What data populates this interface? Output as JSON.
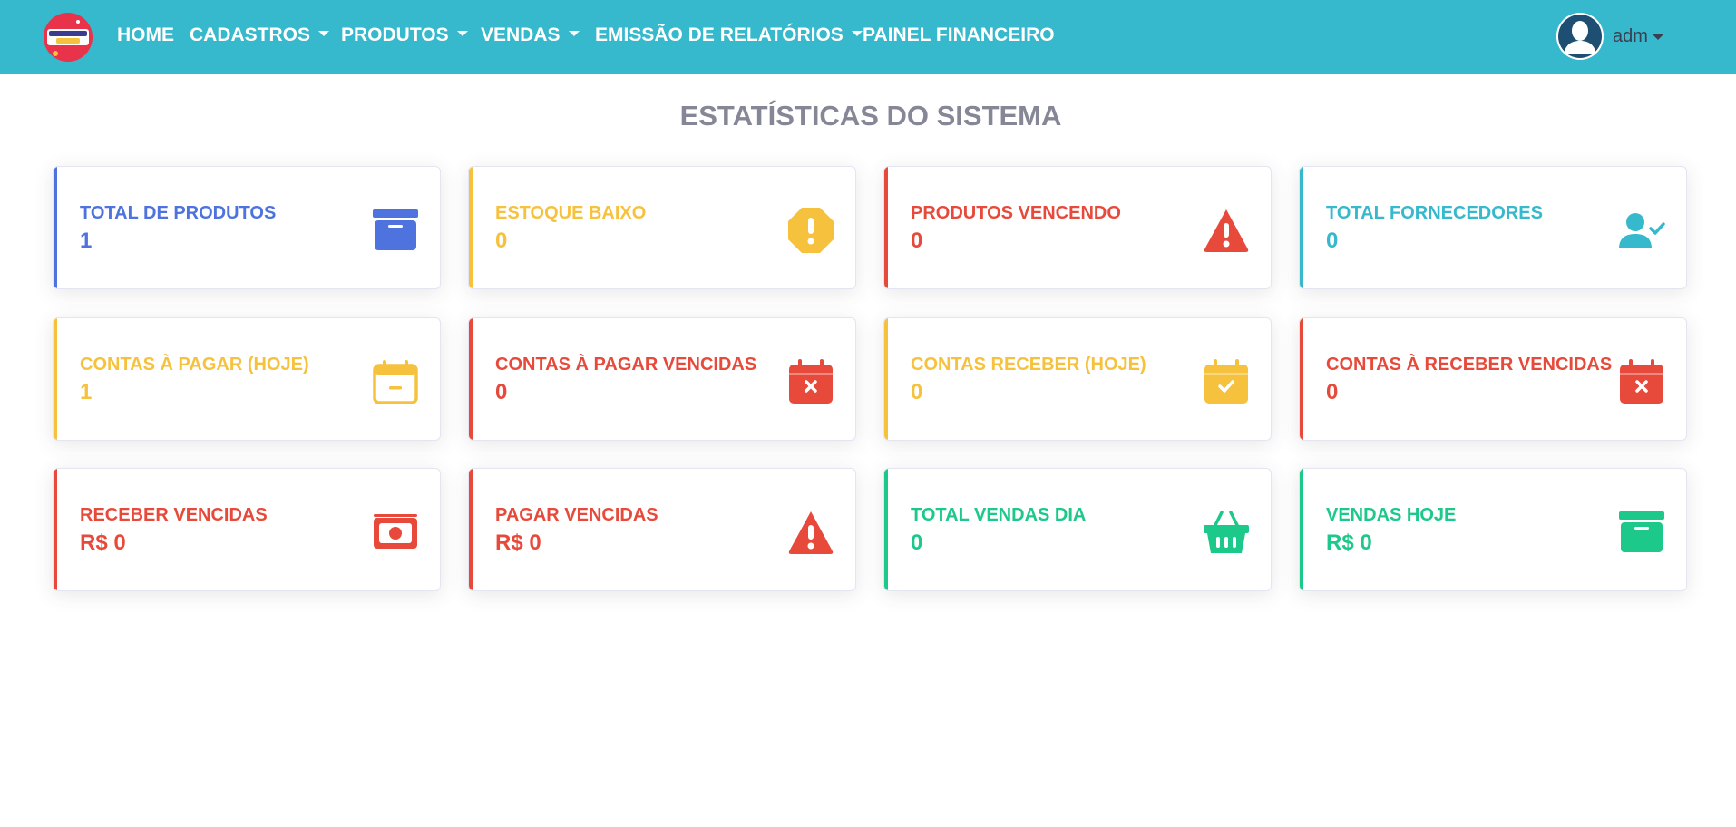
{
  "nav": {
    "items": [
      {
        "label": "HOME"
      },
      {
        "label": "CADASTROS"
      },
      {
        "label": "PRODUTOS"
      },
      {
        "label": "VENDAS"
      },
      {
        "label": "EMISSÃO DE RELATÓRIOS"
      },
      {
        "label": "PAINEL FINANCEIRO"
      }
    ],
    "user": {
      "name": "adm"
    }
  },
  "title": "ESTATÍSTICAS DO SISTEMA",
  "colors": {
    "navbar": "#36b9cc",
    "primary": "#4e73df",
    "warning": "#f6c23e",
    "danger": "#e74a3b",
    "info": "#36b9cc",
    "success": "#1cc88a"
  },
  "cards": [
    {
      "label": "TOTAL DE PRODUTOS",
      "value": "1",
      "color": "#4e73df",
      "icon": "archive-box-icon"
    },
    {
      "label": "ESTOQUE BAIXO",
      "value": "0",
      "color": "#f6c23e",
      "icon": "exclamation-octagon-icon"
    },
    {
      "label": "PRODUTOS VENCENDO",
      "value": "0",
      "color": "#e74a3b",
      "icon": "warning-triangle-icon"
    },
    {
      "label": "TOTAL FORNECEDORES",
      "value": "0",
      "color": "#36b9cc",
      "icon": "user-check-icon"
    },
    {
      "label": "CONTAS À PAGAR (HOJE)",
      "value": "1",
      "color": "#f6c23e",
      "icon": "calendar-minus-icon"
    },
    {
      "label": "CONTAS À PAGAR VENCIDAS",
      "value": "0",
      "color": "#e74a3b",
      "icon": "calendar-x-icon"
    },
    {
      "label": "CONTAS RECEBER (HOJE)",
      "value": "0",
      "color": "#f6c23e",
      "icon": "calendar-check-icon"
    },
    {
      "label": "CONTAS À RECEBER VENCIDAS",
      "value": "0",
      "color": "#e74a3b",
      "icon": "calendar-x-icon"
    },
    {
      "label": "RECEBER VENCIDAS",
      "value": "R$ 0",
      "color": "#e74a3b",
      "icon": "money-bill-icon"
    },
    {
      "label": "PAGAR VENCIDAS",
      "value": "R$ 0",
      "color": "#e74a3b",
      "icon": "warning-triangle-icon"
    },
    {
      "label": "TOTAL VENDAS DIA",
      "value": "0",
      "color": "#1cc88a",
      "icon": "shopping-basket-icon"
    },
    {
      "label": "VENDAS HOJE",
      "value": "R$ 0",
      "color": "#1cc88a",
      "icon": "archive-box-icon"
    }
  ]
}
